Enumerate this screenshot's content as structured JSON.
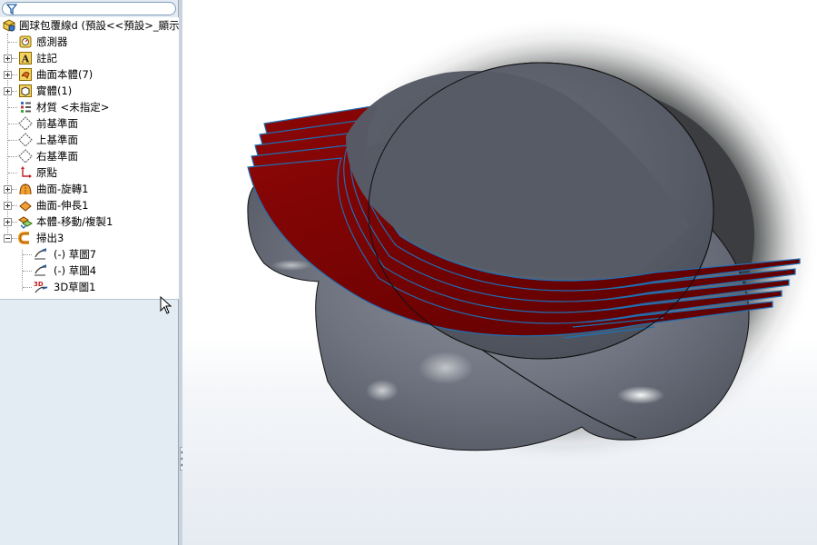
{
  "filter": {
    "icon": "filter-funnel-icon"
  },
  "tree": {
    "root": {
      "label": "圓球包覆線d (預設<<預設>_顯示",
      "icon": "part-icon"
    },
    "items": [
      {
        "label": "感測器",
        "icon": "sensor-icon"
      },
      {
        "label": "註記",
        "icon": "annotation-icon"
      },
      {
        "label": "曲面本體(7)",
        "icon": "surface-bodies-icon"
      },
      {
        "label": "實體(1)",
        "icon": "solid-bodies-icon"
      },
      {
        "label": "材質 <未指定>",
        "icon": "material-icon"
      },
      {
        "label": "前基準面",
        "icon": "plane-icon"
      },
      {
        "label": "上基準面",
        "icon": "plane-icon"
      },
      {
        "label": "右基準面",
        "icon": "plane-icon"
      },
      {
        "label": "原點",
        "icon": "origin-icon"
      },
      {
        "label": "曲面-旋轉1",
        "icon": "revolve-surface-icon"
      },
      {
        "label": "曲面-伸長1",
        "icon": "extrude-surface-icon"
      },
      {
        "label": "本體-移動/複製1",
        "icon": "move-copy-icon"
      },
      {
        "label": "掃出3",
        "icon": "sweep-icon"
      }
    ],
    "sweep_children": [
      {
        "label": "(-) 草圖7",
        "icon": "sketch-icon"
      },
      {
        "label": "(-) 草圖4",
        "icon": "sketch-icon"
      },
      {
        "label": "3D草圖1",
        "icon": "3d-sketch-icon"
      }
    ]
  },
  "colors": {
    "panel_bg": "#e3ebf3",
    "surface_red": "#7a0000",
    "sphere_gray": "#5d616c",
    "edge_blue": "#1f6fb3"
  }
}
